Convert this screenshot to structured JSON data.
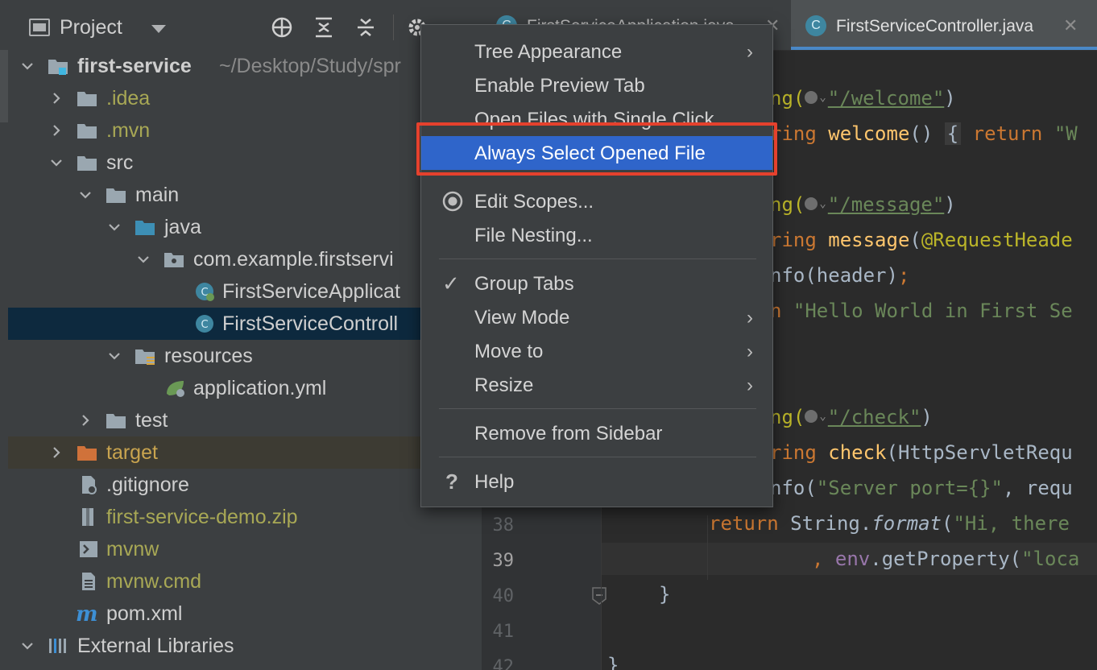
{
  "project_panel": {
    "title": "Project",
    "tree": [
      {
        "label": "first-service",
        "hint": "~/Desktop/Study/spr",
        "icon": "module-folder-icon",
        "expanded": true
      },
      {
        "label": ".idea",
        "icon": "folder-icon",
        "expanded": false
      },
      {
        "label": ".mvn",
        "icon": "folder-icon",
        "expanded": false
      },
      {
        "label": "src",
        "icon": "folder-icon",
        "expanded": true
      },
      {
        "label": "main",
        "icon": "folder-icon",
        "expanded": true
      },
      {
        "label": "java",
        "icon": "source-folder-icon",
        "expanded": true
      },
      {
        "label": "com.example.firstservi",
        "icon": "package-icon",
        "expanded": true
      },
      {
        "label": "FirstServiceApplicat",
        "icon": "spring-boot-class-icon"
      },
      {
        "label": "FirstServiceControll",
        "icon": "class-icon",
        "selected": true
      },
      {
        "label": "resources",
        "icon": "resources-folder-icon",
        "expanded": true
      },
      {
        "label": "application.yml",
        "icon": "spring-config-icon"
      },
      {
        "label": "test",
        "icon": "folder-icon",
        "expanded": false
      },
      {
        "label": "target",
        "icon": "excluded-folder-icon",
        "expanded": false
      },
      {
        "label": ".gitignore",
        "icon": "gitignore-file-icon"
      },
      {
        "label": "first-service-demo.zip",
        "icon": "archive-icon"
      },
      {
        "label": "mvnw",
        "icon": "script-file-icon"
      },
      {
        "label": "mvnw.cmd",
        "icon": "text-file-icon"
      },
      {
        "label": "pom.xml",
        "icon": "maven-icon"
      },
      {
        "label": "External Libraries",
        "icon": "libraries-icon",
        "expanded": true
      }
    ]
  },
  "editor": {
    "tabs": [
      {
        "label": "FirstServiceApplication.java",
        "active": false
      },
      {
        "label": "FirstServiceController.java",
        "active": true
      }
    ],
    "close_glyph": "✕",
    "line_numbers": [
      {
        "n": "38",
        "current": false
      },
      {
        "n": "39",
        "current": true
      },
      {
        "n": "40",
        "current": false
      },
      {
        "n": "41",
        "current": false
      },
      {
        "n": "42",
        "current": false
      }
    ],
    "code": {
      "l1_a": "ng(",
      "l1_url": "\"/welcome\"",
      "l1_b": ")",
      "l2_a": "ring ",
      "l2_fn": "welcome",
      "l2_b": "() ",
      "l2_fold": "{",
      "l2_kw": " return",
      "l2_str": " \"W",
      "l3_a": "ng(",
      "l3_url": "\"/message\"",
      "l3_b": ")",
      "l4_a": "ring ",
      "l4_fn": "message",
      "l4_b": "(",
      "l4_ann": "@RequestHeade",
      "l5_a": "nfo(header)",
      "l5_semi": ";",
      "l6_kw": "n",
      "l6_str": " \"Hello World in First Se",
      "l7_a": "ng(",
      "l7_url": "\"/check\"",
      "l7_b": ")",
      "l8_a": "ring ",
      "l8_fn": "check",
      "l8_b": "(HttpServletRequ",
      "l9_a": "nfo(",
      "l9_str": "\"Server port={}\"",
      "l9_b": ", requ",
      "l10_kw": "return",
      "l10_a": " String.",
      "l10_it": "format",
      "l10_b": "(",
      "l10_str": "\"Hi, there",
      "l11_comma": ", ",
      "l11_field": "env",
      "l11_a": ".getProperty(",
      "l11_str": "\"loca",
      "l12_brace": "}",
      "l14_brace": "}"
    }
  },
  "context_menu": {
    "items": [
      {
        "label": "Tree Appearance",
        "submenu": true
      },
      {
        "label": "Enable Preview Tab"
      },
      {
        "label": "Open Files with Single Click"
      },
      {
        "label": "Always Select Opened File",
        "highlighted": true
      },
      {
        "label": "Edit Scopes...",
        "lead": "radio-icon"
      },
      {
        "label": "File Nesting..."
      },
      {
        "label": "Group Tabs",
        "lead": "check-icon",
        "lead_glyph": "✓"
      },
      {
        "label": "View Mode",
        "submenu": true
      },
      {
        "label": "Move to",
        "submenu": true
      },
      {
        "label": "Resize",
        "submenu": true
      },
      {
        "label": "Remove from Sidebar"
      },
      {
        "label": "Help",
        "lead": "help-icon",
        "lead_glyph": "?"
      }
    ],
    "submenu_glyph": "›"
  },
  "colors": {
    "panel_bg": "#3c3f41",
    "editor_bg": "#2b2b2b",
    "selection": "#0d293e",
    "menu_highlight": "#2f65ca",
    "annotation_frame": "#e5412d"
  }
}
